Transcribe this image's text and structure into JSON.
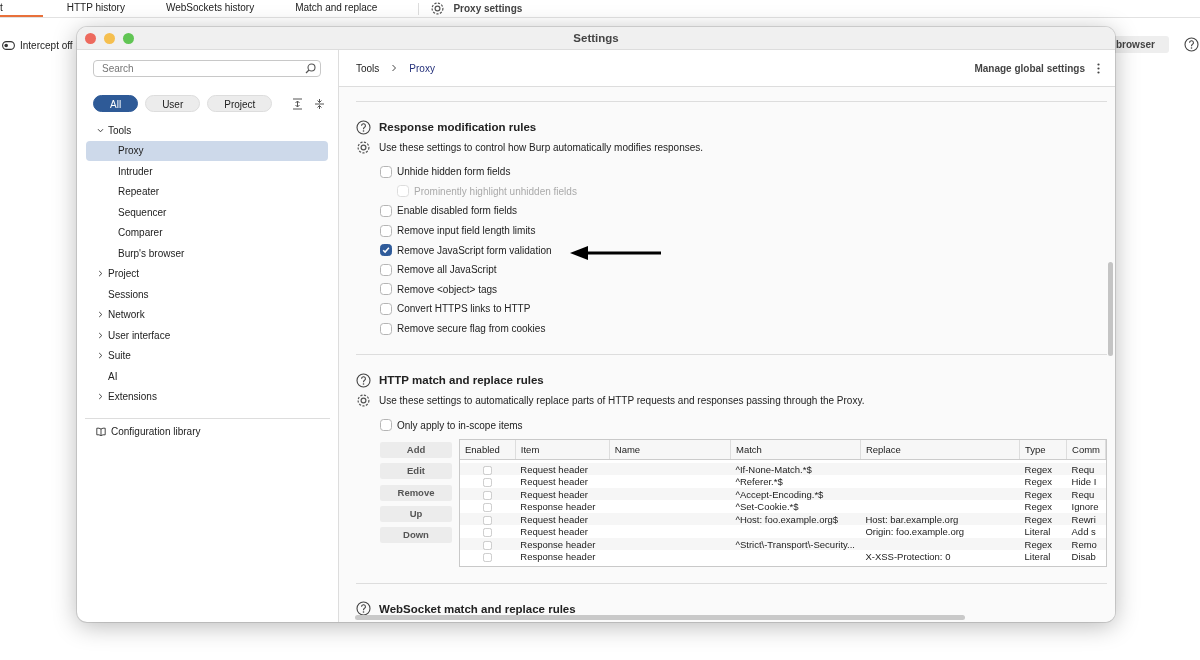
{
  "app_tabs": [
    {
      "label": "t",
      "selected": true
    },
    {
      "label": "HTTP history",
      "selected": false
    },
    {
      "label": "WebSockets history",
      "selected": false
    },
    {
      "label": "Match and replace",
      "selected": false
    }
  ],
  "proxy_settings_tab": {
    "label": "Proxy settings"
  },
  "intercept": {
    "label": "Intercept off"
  },
  "browser_button": {
    "label": "browser"
  },
  "window": {
    "title": "Settings"
  },
  "sidebar": {
    "search_placeholder": "Search",
    "filters": [
      {
        "label": "All",
        "selected": true
      },
      {
        "label": "User",
        "selected": false
      },
      {
        "label": "Project",
        "selected": false
      }
    ],
    "items": [
      {
        "label": "Tools",
        "kind": "group",
        "expanded": true,
        "selected": false,
        "children": [
          {
            "label": "Proxy",
            "selected": true
          },
          {
            "label": "Intruder",
            "selected": false
          },
          {
            "label": "Repeater",
            "selected": false
          },
          {
            "label": "Sequencer",
            "selected": false
          },
          {
            "label": "Comparer",
            "selected": false
          },
          {
            "label": "Burp's browser",
            "selected": false
          }
        ]
      },
      {
        "label": "Project",
        "kind": "group",
        "expanded": false,
        "selected": false
      },
      {
        "label": "Sessions",
        "kind": "leaf",
        "selected": false
      },
      {
        "label": "Network",
        "kind": "group",
        "expanded": false,
        "selected": false
      },
      {
        "label": "User interface",
        "kind": "group",
        "expanded": false,
        "selected": false
      },
      {
        "label": "Suite",
        "kind": "group",
        "expanded": false,
        "selected": false
      },
      {
        "label": "AI",
        "kind": "leaf",
        "selected": false
      },
      {
        "label": "Extensions",
        "kind": "group",
        "expanded": false,
        "selected": false
      }
    ],
    "library": "Configuration library"
  },
  "breadcrumb": [
    "Tools",
    "Proxy"
  ],
  "manage_global": "Manage global settings",
  "sections": [
    {
      "title": "Response modification rules",
      "description": "Use these settings to control how Burp automatically modifies responses.",
      "options": [
        {
          "label": "Unhide hidden form fields",
          "checked": false,
          "disabled": false,
          "children": [
            {
              "label": "Prominently highlight unhidden fields",
              "checked": false,
              "disabled": true
            }
          ]
        },
        {
          "label": "Enable disabled form fields",
          "checked": false,
          "disabled": false
        },
        {
          "label": "Remove input field length limits",
          "checked": false,
          "disabled": false
        },
        {
          "label": "Remove JavaScript form validation",
          "checked": true,
          "disabled": false
        },
        {
          "label": "Remove all JavaScript",
          "checked": false,
          "disabled": false
        },
        {
          "label": "Remove <object> tags",
          "checked": false,
          "disabled": false
        },
        {
          "label": "Convert HTTPS links to HTTP",
          "checked": false,
          "disabled": false
        },
        {
          "label": "Remove secure flag from cookies",
          "checked": false,
          "disabled": false
        }
      ]
    },
    {
      "title": "HTTP match and replace rules",
      "description": "Use these settings to automatically replace parts of HTTP requests and responses passing through the Proxy.",
      "options": [
        {
          "label": "Only apply to in-scope items",
          "checked": false,
          "disabled": false
        }
      ],
      "buttons": [
        "Add",
        "Edit",
        "Remove",
        "Up",
        "Down"
      ],
      "table": {
        "enabled_column": "Enabled",
        "columns": [
          "Item",
          "Name",
          "Match",
          "Replace",
          "Type",
          "Comm"
        ],
        "rows": [
          {
            "enabled": false,
            "cells": [
              "Request header",
              "",
              "^If-None-Match.*$",
              "",
              "Regex",
              "Requ"
            ]
          },
          {
            "enabled": false,
            "cells": [
              "Request header",
              "",
              "^Referer.*$",
              "",
              "Regex",
              "Hide I"
            ]
          },
          {
            "enabled": false,
            "cells": [
              "Request header",
              "",
              "^Accept-Encoding.*$",
              "",
              "Regex",
              "Requ"
            ]
          },
          {
            "enabled": false,
            "cells": [
              "Response header",
              "",
              "^Set-Cookie.*$",
              "",
              "Regex",
              "Ignore"
            ]
          },
          {
            "enabled": false,
            "cells": [
              "Request header",
              "",
              "^Host: foo.example.org$",
              "Host: bar.example.org",
              "Regex",
              "Rewri"
            ]
          },
          {
            "enabled": false,
            "cells": [
              "Request header",
              "",
              "",
              "Origin: foo.example.org",
              "Literal",
              "Add s"
            ]
          },
          {
            "enabled": false,
            "cells": [
              "Response header",
              "",
              "^Strict\\-Transport\\-Security...",
              "",
              "Regex",
              "Remo"
            ]
          },
          {
            "enabled": false,
            "cells": [
              "Response header",
              "",
              "",
              "X-XSS-Protection: 0",
              "Literal",
              "Disab"
            ]
          }
        ]
      }
    },
    {
      "title": "WebSocket match and replace rules"
    }
  ]
}
